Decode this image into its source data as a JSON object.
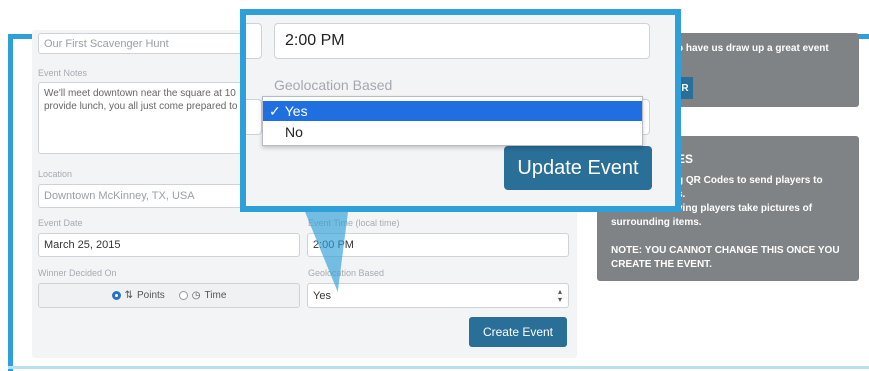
{
  "form": {
    "title_value": "Our First Scavenger Hunt",
    "notes_label": "Event Notes",
    "notes_line1": "We'll meet downtown near the square at 10",
    "notes_line2": "provide lunch, you all just come prepared to",
    "location_label": "Location",
    "location_value": "Downtown McKinney, TX, USA",
    "date_label": "Event Date",
    "date_value": "March 25, 2015",
    "time_label": "Event Time (local time)",
    "time_value": "2:00 PM",
    "winner_label": "Winner Decided On",
    "winner_options": [
      "Points",
      "Time"
    ],
    "winner_selected": "Points",
    "geo_label": "Geolocation Based",
    "geo_value": "Yes",
    "create_button": "Create Event"
  },
  "sidebar": {
    "card1_text": "o have us draw up a great event",
    "card1_button": "R",
    "card2_heading": "ES",
    "card2_line1": "g QR Codes to send players to",
    "card2_line2": "s.",
    "card2_line3": "ving players take pictures of",
    "card2_line4": "surrounding items.",
    "card2_note1": "NOTE: YOU CANNOT CHANGE THIS ONCE YOU",
    "card2_note2": "CREATE THE EVENT."
  },
  "zoom": {
    "time_value": "2:00 PM",
    "geo_label": "Geolocation Based",
    "options": [
      "Yes",
      "No"
    ],
    "selected": "Yes",
    "check_mark": "✓",
    "update_button": "Update Event"
  },
  "colors": {
    "accent_frame": "#2e9fd8",
    "button": "#2a6f98",
    "card": "#808385",
    "selection": "#1f6fe0"
  }
}
